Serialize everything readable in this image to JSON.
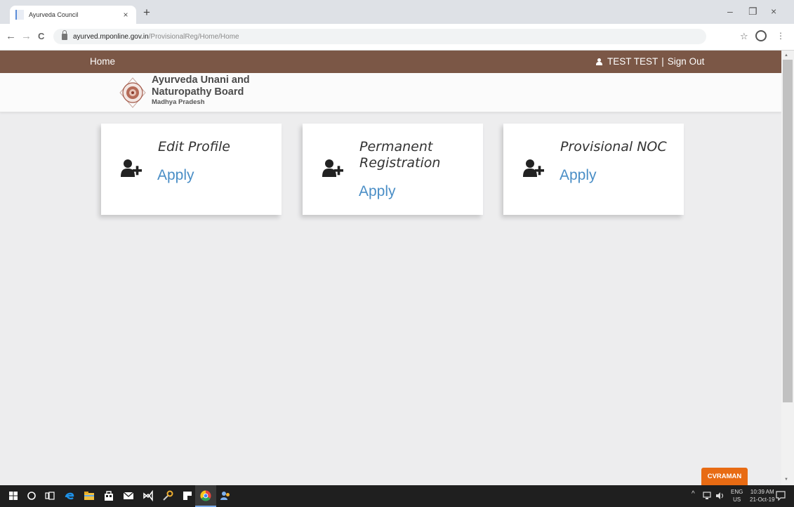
{
  "browser": {
    "tab_title": "Ayurveda Council",
    "tab_close": "×",
    "new_tab": "+",
    "url_host": "ayurved.mponline.gov.in",
    "url_path": "/ProvisionalReg/Home/Home",
    "window_controls": [
      "–",
      "❐",
      "×"
    ],
    "nav": {
      "back": "←",
      "forward": "→",
      "reload": "C"
    },
    "star": "☆",
    "account": "θ",
    "menu": "⋮"
  },
  "topnav": {
    "home": "Home",
    "user_name": "TEST TEST",
    "separator": "|",
    "sign_out": "Sign Out"
  },
  "header": {
    "org_line1": "Ayurveda Unani and",
    "org_line2": "Naturopathy Board",
    "org_line3": "Madhya Pradesh"
  },
  "cards": [
    {
      "title_line1": "Edit Profile",
      "title_line2": "",
      "apply": "Apply"
    },
    {
      "title_line1": "Permanent",
      "title_line2": "Registration",
      "apply": "Apply"
    },
    {
      "title_line1": "Provisional NOC",
      "title_line2": "",
      "apply": "Apply"
    }
  ],
  "badge": {
    "label": "CVRAMAN"
  },
  "taskbar": {
    "lang_line1": "ENG",
    "lang_line2": "US",
    "time": "10:39 AM",
    "date": "21-Oct-19",
    "tray_chevron": "^"
  },
  "colors": {
    "nav_bar": "#7b5746",
    "apply_link": "#4a8ec6",
    "page_bg": "#ededee",
    "badge": "#e86b13"
  }
}
